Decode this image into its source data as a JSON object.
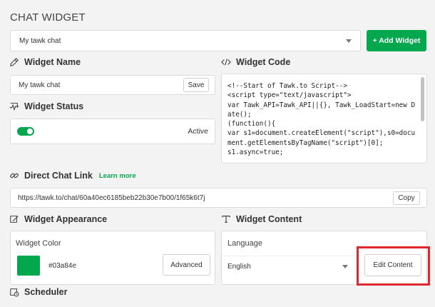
{
  "page_title": "CHAT WIDGET",
  "widget_select": {
    "value": "My tawk chat"
  },
  "add_widget_label": "+ Add Widget",
  "widget_name": {
    "heading": "Widget Name",
    "value": "My tawk chat",
    "save_label": "Save"
  },
  "widget_code": {
    "heading": "Widget Code",
    "text": "<!--Start of Tawk.to Script-->\n<script type=\"text/javascript\">\nvar Tawk_API=Tawk_API||{}, Tawk_LoadStart=new Date();\n(function(){\nvar s1=document.createElement(\"script\"),s0=document.getElementsByTagName(\"script\")[0];\ns1.async=true;"
  },
  "widget_status": {
    "heading": "Widget Status",
    "state_label": "Active",
    "enabled": true
  },
  "direct_chat_link": {
    "heading": "Direct Chat Link",
    "learn_more": "Learn more",
    "url": "https://tawk.to/chat/60a40ec6185beb22b30e7b00/1f65k6t7j",
    "copy_label": "Copy"
  },
  "widget_appearance": {
    "heading": "Widget Appearance",
    "color_label": "Widget Color",
    "color_value": "#03a84e",
    "advanced_label": "Advanced"
  },
  "widget_content": {
    "heading": "Widget Content",
    "language_label": "Language",
    "language_value": "English",
    "edit_content_label": "Edit Content"
  },
  "scheduler": {
    "heading": "Scheduler"
  },
  "colors": {
    "accent": "#03a84e",
    "highlight": "#e0262f"
  }
}
